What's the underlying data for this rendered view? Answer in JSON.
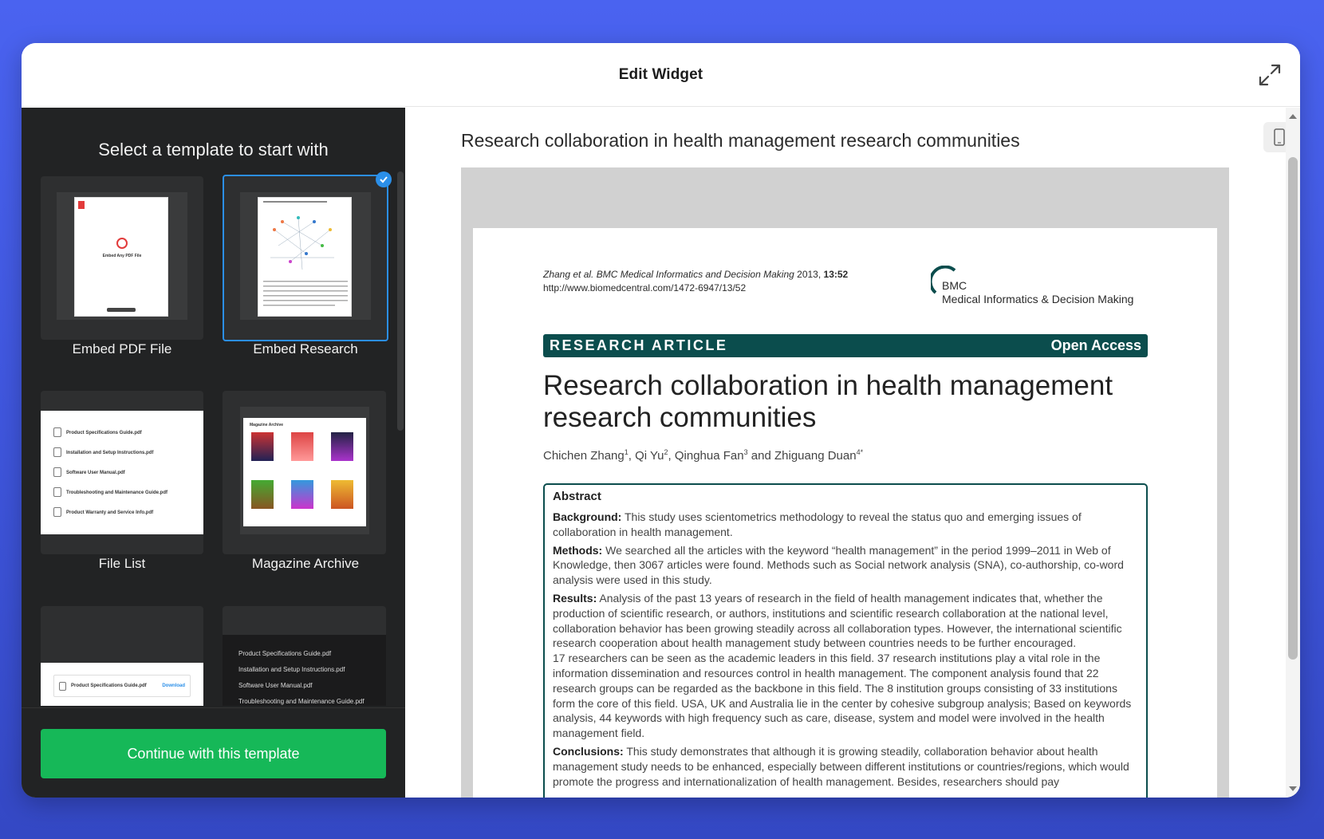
{
  "modal": {
    "title": "Edit Widget"
  },
  "left": {
    "title": "Select a template to start with",
    "templates": [
      {
        "label": "Embed PDF File",
        "selected": false
      },
      {
        "label": "Embed Research",
        "selected": true
      },
      {
        "label": "File List",
        "selected": false
      },
      {
        "label": "Magazine Archive",
        "selected": false
      }
    ],
    "continue_label": "Continue with this template",
    "thumbs": {
      "pdf_embed_title": "Embed Any PDF File",
      "file_list_items": [
        "Product Specifications Guide.pdf",
        "Installation and Setup Instructions.pdf",
        "Software User Manual.pdf",
        "Troubleshooting and Maintenance Guide.pdf",
        "Product Warranty and Service Info.pdf"
      ],
      "magazine_header": "Magazine Archive",
      "single_file": "Product Specifications Guide.pdf",
      "single_file_action": "Download",
      "dark_list_items": [
        "Product Specifications Guide.pdf",
        "Installation and Setup Instructions.pdf",
        "Software User Manual.pdf",
        "Troubleshooting and Maintenance Guide.pdf"
      ]
    }
  },
  "right": {
    "doc_title": "Research collaboration in health management research communities",
    "paper": {
      "citation_line1_pre": "Zhang et al. BMC Medical Informatics and Decision Making",
      "citation_line1_year": "2013,",
      "citation_line1_vol": "13:52",
      "citation_url": "http://www.biomedcentral.com/1472-6947/13/52",
      "journal_brand": "BMC",
      "journal_name": "Medical Informatics & Decision Making",
      "article_type": "RESEARCH ARTICLE",
      "access": "Open Access",
      "title": "Research collaboration in health management research communities",
      "authors": [
        {
          "name": "Chichen Zhang",
          "sup": "1"
        },
        {
          "name": "Qi Yu",
          "sup": "2"
        },
        {
          "name": "Qinghua Fan",
          "sup": "3"
        },
        {
          "name": "Zhiguang Duan",
          "sup": "4*"
        }
      ],
      "author_sep1": ", ",
      "author_sep_and": " and ",
      "abstract_heading": "Abstract",
      "background_label": "Background:",
      "background": "This study uses scientometrics methodology to reveal the status quo and emerging issues of collaboration in health management.",
      "methods_label": "Methods:",
      "methods": "We searched all the articles with the keyword “health management” in the period 1999–2011 in Web of Knowledge, then 3067 articles were found. Methods such as Social network analysis (SNA), co-authorship, co-word analysis were used in this study.",
      "results_label": "Results:",
      "results": "Analysis of the past 13 years of research in the field of health management indicates that, whether the production of scientific research, or authors, institutions and scientific research collaboration at the national level, collaboration behavior has been growing steadily across all collaboration types. However, the international scientific research cooperation about health management study between countries needs to be further encouraged.",
      "results2": "17 researchers can be seen as the academic leaders in this field. 37 research institutions play a vital role in the information dissemination and resources control in health management. The component analysis found that 22 research groups can be regarded as the backbone in this field. The 8 institution groups consisting of 33 institutions form the core of this field. USA, UK and Australia lie in the center by cohesive subgroup analysis; Based on keywords analysis, 44 keywords with high frequency such as care, disease, system and model were involved in the health management field.",
      "conclusions_label": "Conclusions:",
      "conclusions": "This study demonstrates that although it is growing steadily, collaboration behavior about health management study needs to be enhanced, especially between different institutions or countries/regions, which would promote the progress and internationalization of health management. Besides, researchers should pay"
    }
  },
  "colors": {
    "bg": "#4059e8",
    "panel_dark": "#222324",
    "accent_green": "#16b858",
    "select_blue": "#2b8fe8",
    "journal_teal": "#0b4d4d"
  },
  "icons": [
    "expand-icon",
    "check-icon",
    "mobile-device-icon",
    "pdf-file-icon"
  ]
}
